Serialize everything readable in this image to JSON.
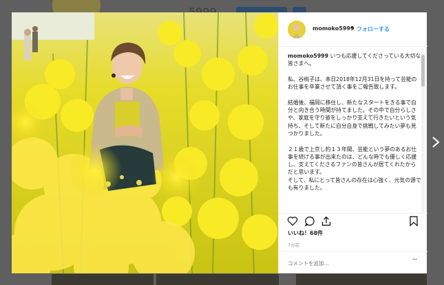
{
  "background": {
    "username": "5999"
  },
  "post": {
    "username": "momoko5999",
    "dot": "•",
    "follow_label": "フォローする",
    "caption_user": "momoko5999",
    "caption_body": " いつも応援してくださっている大切な皆さまへ。\n\n私、谷桃子は、本日2018年12月31日を持って芸能のお仕事を卒業させて頂く事をご報告致します。\n\n結婚後、福岡に移住し、新たなスタートをきる事で自分と向き合う時間が持てました。その中で自分らしさや、家庭を守り彼をしっかり支えて行きたいという気持ち、そして新たに自分自身で挑戦してみたい夢も見つかりました。\n\n２１歳で上京し約１３年間、芸能という夢のあるお仕事を続ける事が出来たのは、どんな時でも優しく応援し、支えてくださるファンの皆さんが居てくれたからだと思います。\nそして、私にとって皆さんの存在は心強く、元気の源でも有りました。",
    "likes": "いいね！68件",
    "time_ago": "7分前",
    "comment_placeholder": "コメントを追加...",
    "more_label": "···"
  },
  "icons": {
    "heart": "heart-icon",
    "comment": "comment-icon",
    "share": "share-icon",
    "bookmark": "bookmark-icon",
    "next": "chevron-right-icon"
  },
  "colors": {
    "follow": "#3897f0",
    "flowers": "#f5e52a"
  }
}
